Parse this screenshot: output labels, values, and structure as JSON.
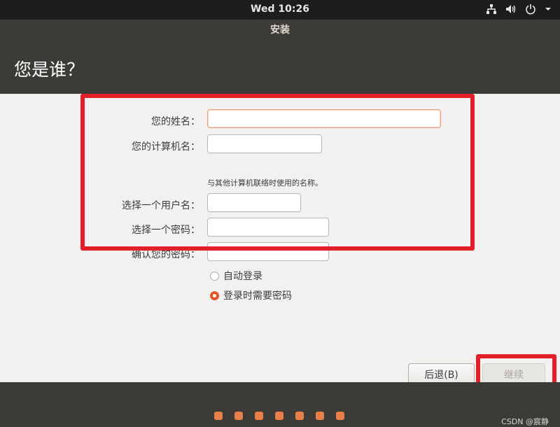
{
  "topbar": {
    "clock": "Wed 10:26",
    "icons": [
      "network-icon",
      "volume-icon",
      "power-icon",
      "chevron-down-icon"
    ]
  },
  "window": {
    "title": "安装"
  },
  "page": {
    "title": "您是谁？"
  },
  "form": {
    "name_label": "您的姓名：",
    "name_value": "",
    "computer_label": "您的计算机名：",
    "computer_value": "",
    "computer_hint": "与其他计算机联络时使用的名称。",
    "username_label": "选择一个用户名：",
    "username_value": "",
    "password_label": "选择一个密码：",
    "password_value": "",
    "confirm_label": "确认您的密码：",
    "confirm_value": ""
  },
  "login": {
    "auto_label": "自动登录",
    "require_label": "登录时需要密码",
    "selected": "require"
  },
  "buttons": {
    "back": "后退(B)",
    "continue": "继续"
  },
  "progress": {
    "total_steps": 7
  },
  "watermark": "CSDN @宸静",
  "colors": {
    "accent": "#e95420",
    "highlight": "#e3202a",
    "panel": "#3c3b37",
    "content_bg": "#f2f1ef"
  }
}
